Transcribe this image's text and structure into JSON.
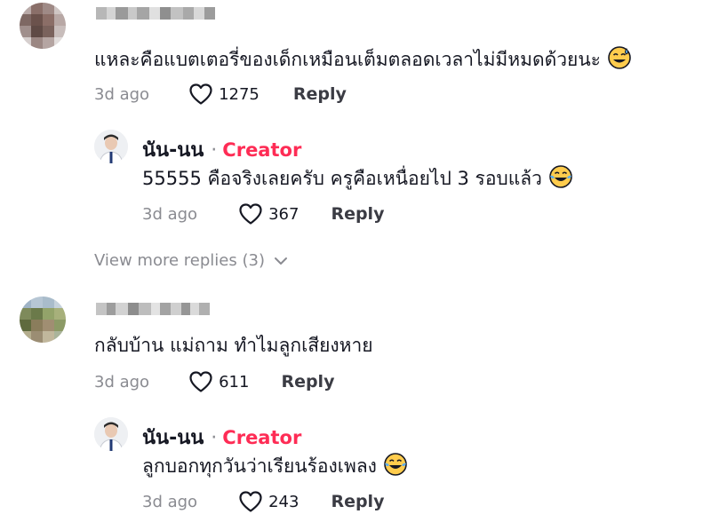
{
  "comments": [
    {
      "text": "แหละคือแบตเตอรี่ของเด็กเหมือนเต็มตลอดเวลาไม่มีหมดด้วยนะ",
      "emoji": "sweat-smile-emoji",
      "date": "3d ago",
      "likes": "1275",
      "reply_label": "Reply",
      "reply": {
        "author": "นัน-นน",
        "separator": "·",
        "badge": "Creator",
        "text": "55555 คือจริงเลยครับ ครูคือเหนื่อยไป 3 รอบแล้ว",
        "emoji": "tears-of-joy-emoji",
        "date": "3d ago",
        "likes": "367",
        "reply_label": "Reply"
      },
      "view_more": "View more replies (3)"
    },
    {
      "text": "กลับบ้าน แม่ถาม ทำไมลูกเสียงหาย",
      "date": "3d ago",
      "likes": "611",
      "reply_label": "Reply",
      "reply": {
        "author": "นัน-นน",
        "separator": "·",
        "badge": "Creator",
        "text": "ลูกบอกทุกวันว่าเรียนร้องเพลง",
        "emoji": "tears-of-joy-emoji",
        "date": "3d ago",
        "likes": "243",
        "reply_label": "Reply"
      }
    }
  ],
  "colors": {
    "creator_badge": "#fe2c55",
    "secondary_text": "#8a8b91",
    "primary_text": "#161823"
  }
}
